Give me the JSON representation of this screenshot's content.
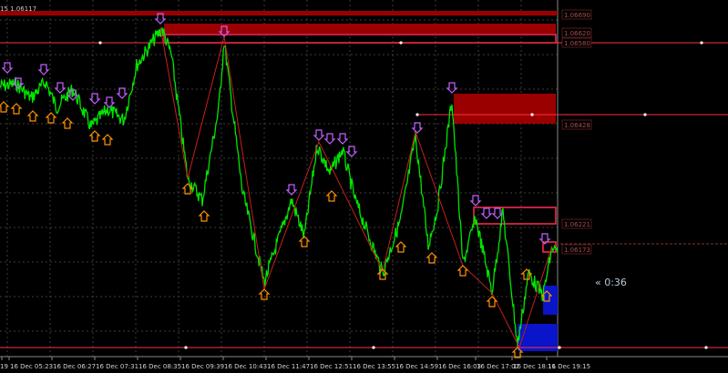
{
  "header": {
    "symbol_info": "15 1.06117"
  },
  "countdown": "« 0:36",
  "colors": {
    "background": "#000000",
    "grid": "#3c3c3c",
    "price_line": "#00e600",
    "zigzag": "#c81e1e",
    "supply_zone": "#9b0000",
    "supply_border": "#ff2a55",
    "demand_zone": "#0a14c8",
    "level_line": "#ff3040",
    "arrow_down": "#c060ff",
    "arrow_up": "#ff9000",
    "axis_text": "#d0d0d0"
  },
  "price_labels": [
    "1.06690",
    "1.06620",
    "1.06580",
    "1.06428",
    "1.06221",
    "1.06173"
  ],
  "time_labels": [
    "19",
    "16 Dec 05:23",
    "16 Dec 06:27",
    "16 Dec 07:31",
    "16 Dec 08:35",
    "16 Dec 09:39",
    "16 Dec 10:43",
    "16 Dec 11:47",
    "16 Dec 12:51",
    "16 Dec 13:55",
    "16 Dec 14:59",
    "16 Dec 16:03",
    "16 Dec 17:07",
    "16 Dec 18:11",
    "16 Dec 19:15"
  ],
  "chart_data": {
    "type": "line",
    "title": "",
    "xlabel": "",
    "ylabel": "",
    "ylim": [
      1.0598,
      1.0671
    ],
    "grid": true,
    "x": [
      "19",
      "16 Dec 05:23",
      "16 Dec 06:27",
      "16 Dec 07:31",
      "16 Dec 08:35",
      "16 Dec 09:39",
      "16 Dec 10:43",
      "16 Dec 11:47",
      "16 Dec 12:51",
      "16 Dec 13:55",
      "16 Dec 14:59",
      "16 Dec 16:03",
      "16 Dec 17:07",
      "16 Dec 18:11",
      "16 Dec 19:15"
    ],
    "series": [
      {
        "values": [
          1.0652,
          1.0651,
          1.0652,
          1.065,
          1.0661,
          1.0638,
          1.0647,
          1.0618,
          1.0639,
          1.0632,
          1.0621,
          1.0646,
          1.0619,
          1.061,
          1.0618
        ]
      }
    ],
    "price_levels": [
      1.0669,
      1.0662,
      1.0658,
      1.06428,
      1.06221,
      1.06173
    ]
  }
}
